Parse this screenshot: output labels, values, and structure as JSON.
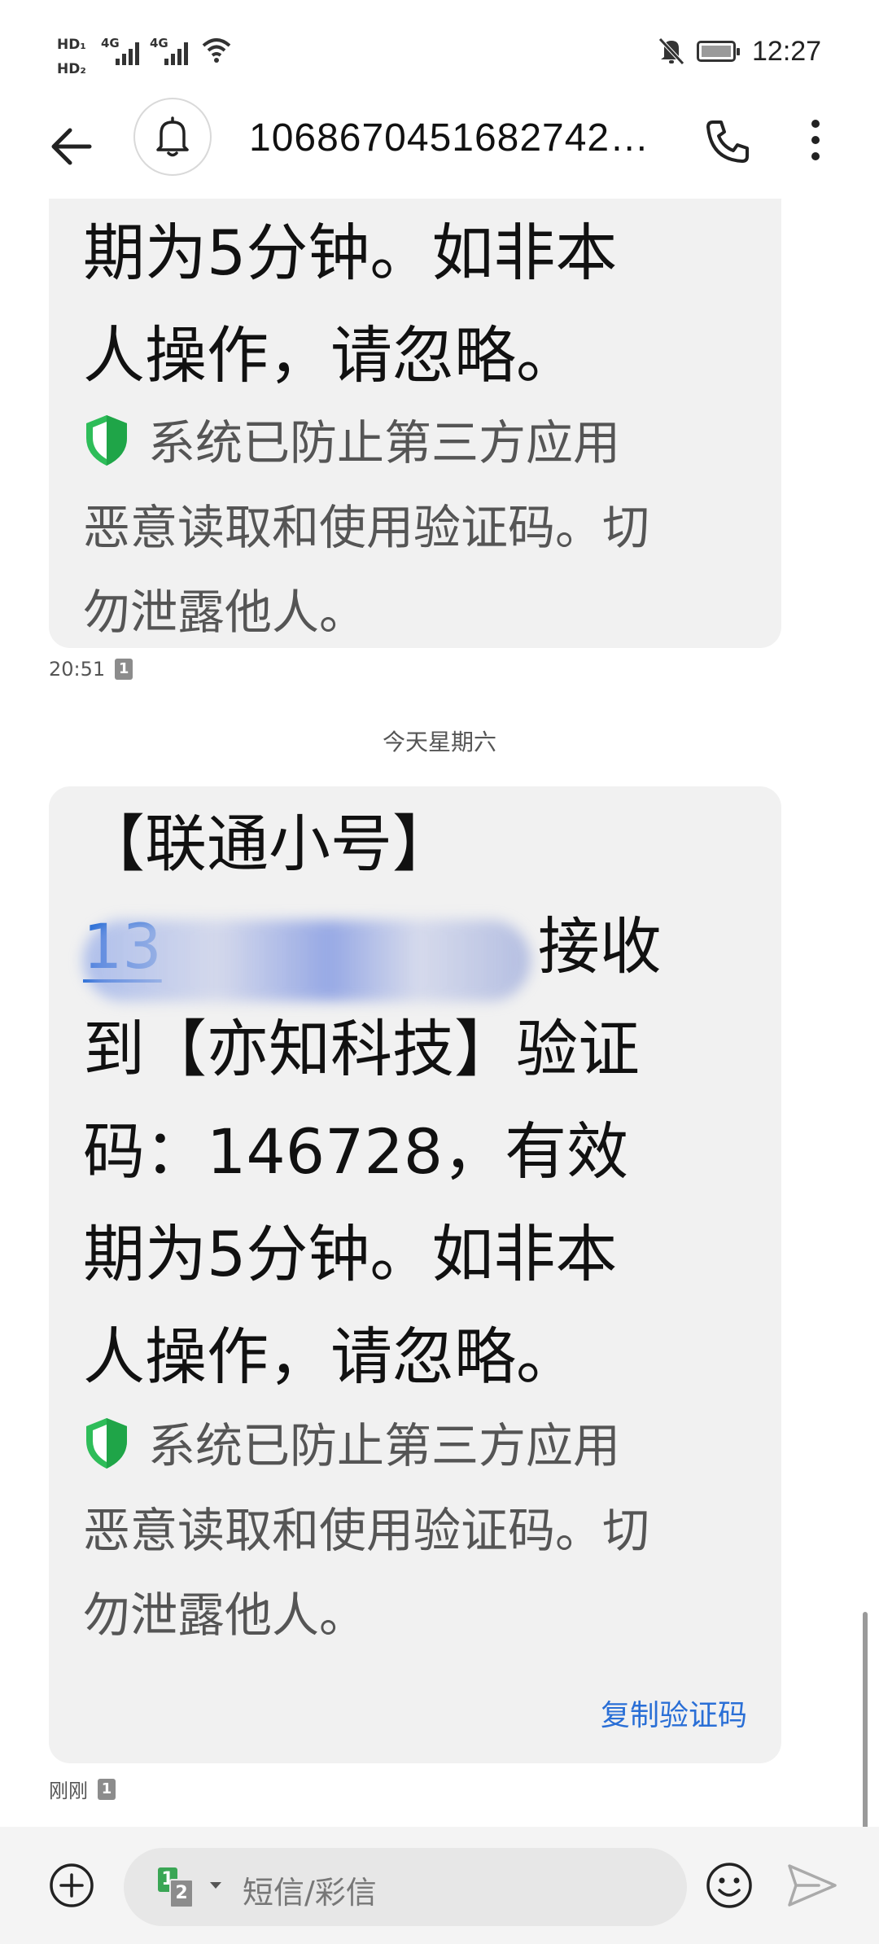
{
  "status_bar": {
    "hd1": "HD₁",
    "hd2": "HD₂",
    "net1": "4G",
    "net2": "4G",
    "time": "12:27",
    "icons": [
      "hd-icon",
      "signal-icon",
      "wifi-icon",
      "mute-icon",
      "battery-icon"
    ]
  },
  "header": {
    "title": "1068670451682742…",
    "icons": [
      "back-arrow-icon",
      "bell-icon",
      "phone-icon",
      "more-vertical-icon"
    ]
  },
  "messages": [
    {
      "body_lines": [
        "期为5分钟。如非本",
        "人操作，请忽略。"
      ],
      "secure_lines": [
        "系统已防止第三方应用",
        "恶意读取和使用验证码。切",
        "勿泄露他人。"
      ],
      "time": "20:51",
      "sim": "1"
    },
    {
      "body_lines": [
        "【联通小号】",
        "接收",
        "到【亦知科技】验证",
        "码：146728，有效",
        "期为5分钟。如非本",
        "人操作，请忽略。"
      ],
      "phone_number_visible": "13",
      "secure_lines": [
        "系统已防止第三方应用",
        "恶意读取和使用验证码。切",
        "勿泄露他人。"
      ],
      "copy_code_label": "复制验证码",
      "time": "刚刚",
      "sim": "1"
    }
  ],
  "date_separator": "今天星期六",
  "compose": {
    "placeholder": "短信/彩信",
    "sim_primary": "1",
    "sim_secondary": "2",
    "icons": [
      "add-icon",
      "sim-select-icon",
      "emoji-icon",
      "send-icon"
    ]
  },
  "colors": {
    "link": "#2a6fd6",
    "bubble": "#f1f1f1",
    "shield": "#2ebd59",
    "compose_bg": "#f4f4f4"
  }
}
